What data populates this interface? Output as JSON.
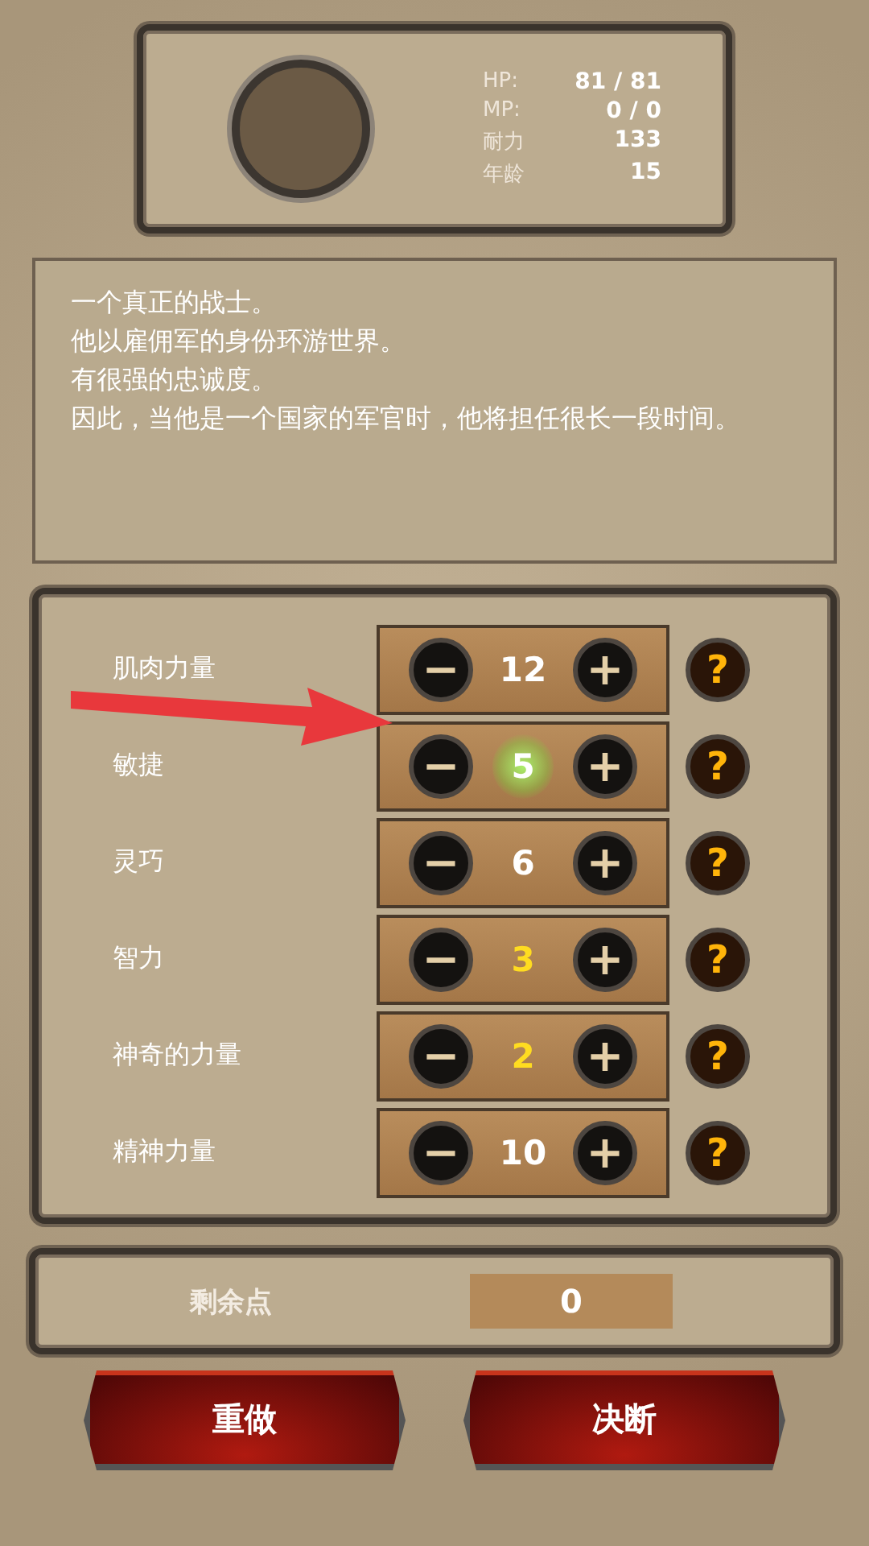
{
  "profile": {
    "stats": [
      {
        "label": "HP:",
        "value": "81 / 81"
      },
      {
        "label": "MP:",
        "value": "0 / 0"
      },
      {
        "label": "耐力",
        "value": "133"
      },
      {
        "label": "年龄",
        "value": "15"
      }
    ]
  },
  "description": [
    "一个真正的战士。",
    "他以雇佣军的身份环游世界。",
    "有很强的忠诚度。",
    "因此，当他是一个国家的军官时，他将担任很长一段时间。"
  ],
  "attributes": [
    {
      "label": "肌肉力量",
      "value": "12",
      "highlighted": false,
      "pointed": false,
      "minus": "−",
      "plus": "+",
      "help": "?"
    },
    {
      "label": "敏捷",
      "value": "5",
      "highlighted": false,
      "pointed": true,
      "minus": "−",
      "plus": "+",
      "help": "?"
    },
    {
      "label": "灵巧",
      "value": "6",
      "highlighted": false,
      "pointed": false,
      "minus": "−",
      "plus": "+",
      "help": "?"
    },
    {
      "label": "智力",
      "value": "3",
      "highlighted": true,
      "pointed": false,
      "minus": "−",
      "plus": "+",
      "help": "?"
    },
    {
      "label": "神奇的力量",
      "value": "2",
      "highlighted": true,
      "pointed": false,
      "minus": "−",
      "plus": "+",
      "help": "?"
    },
    {
      "label": "精神力量",
      "value": "10",
      "highlighted": false,
      "pointed": false,
      "minus": "−",
      "plus": "+",
      "help": "?"
    }
  ],
  "remaining": {
    "label": "剩余点",
    "value": "0"
  },
  "buttons": [
    "重做",
    "决断"
  ]
}
